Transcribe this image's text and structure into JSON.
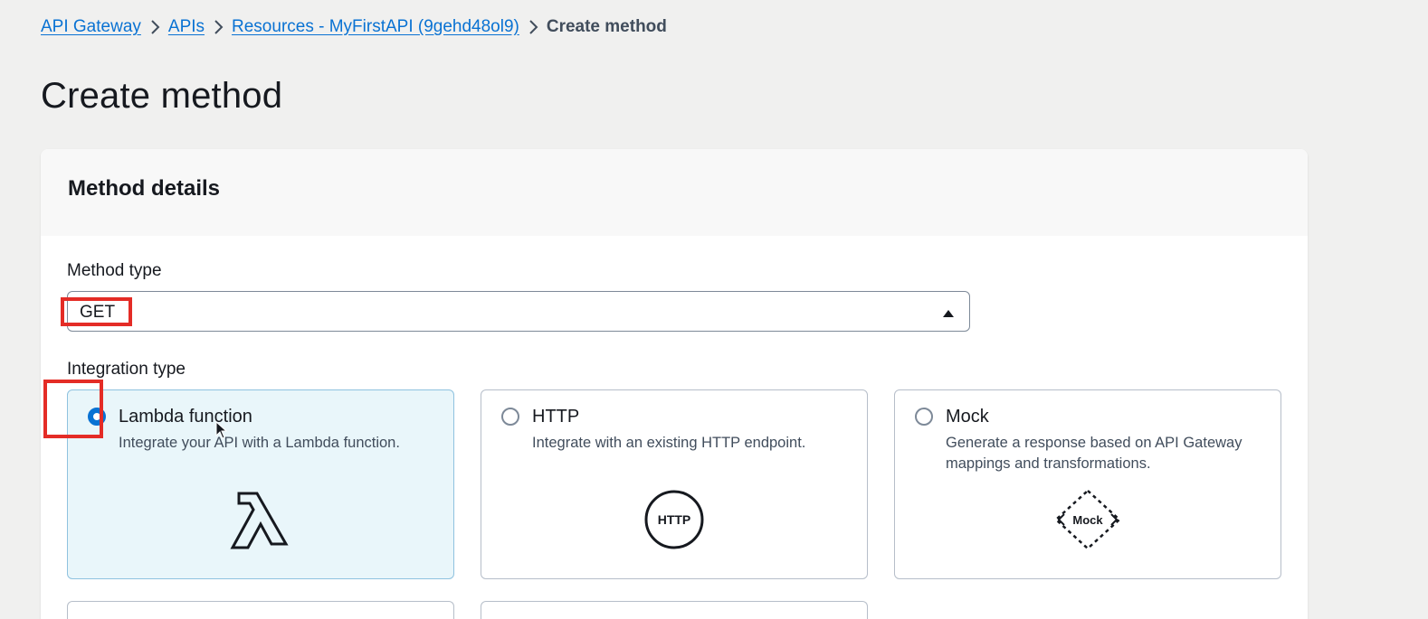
{
  "breadcrumb": {
    "items": [
      {
        "label": "API Gateway"
      },
      {
        "label": "APIs"
      },
      {
        "label": "Resources - MyFirstAPI (9gehd48ol9)"
      }
    ],
    "current": "Create method"
  },
  "page": {
    "title": "Create method"
  },
  "method_details": {
    "header": "Method details",
    "method_type": {
      "label": "Method type",
      "value": "GET"
    },
    "integration_type": {
      "label": "Integration type",
      "selected": "Lambda function",
      "options": [
        {
          "title": "Lambda function",
          "description": "Integrate your API with a Lambda function.",
          "icon_label": "λ"
        },
        {
          "title": "HTTP",
          "description": "Integrate with an existing HTTP endpoint.",
          "icon_label": "HTTP"
        },
        {
          "title": "Mock",
          "description": "Generate a response based on API Gateway mappings and transformations.",
          "icon_label": "Mock"
        }
      ]
    }
  },
  "colors": {
    "link": "#0972d3",
    "selected_bg": "#e9f6fa",
    "highlight": "#e42c26"
  }
}
